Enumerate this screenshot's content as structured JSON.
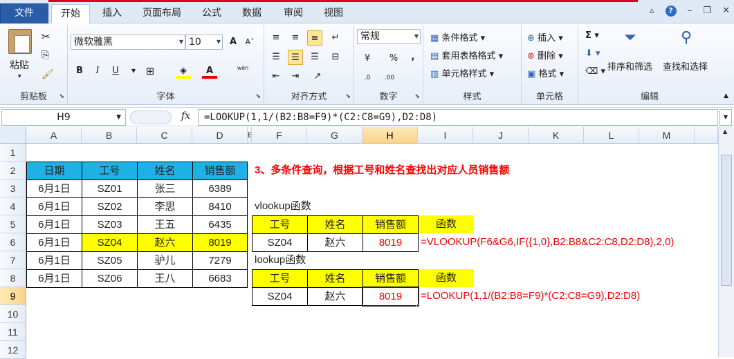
{
  "tabs": {
    "file": "文件",
    "home": "开始",
    "insert": "插入",
    "layout": "页面布局",
    "formulas": "公式",
    "data": "数据",
    "review": "审阅",
    "view": "视图"
  },
  "ribbon": {
    "clipboard": {
      "label": "剪贴板",
      "paste": "粘贴"
    },
    "font": {
      "label": "字体",
      "name": "微软雅黑",
      "size": "10",
      "bold": "B",
      "italic": "I",
      "underline": "U",
      "font_color_glyph": "A",
      "bigger": "A",
      "phonetic": "wén"
    },
    "align": {
      "label": "对齐方式"
    },
    "number": {
      "label": "数字",
      "format": "常规",
      "percent": "%",
      "comma": ","
    },
    "styles": {
      "label": "样式",
      "cond": "条件格式",
      "table": "套用表格格式",
      "cell": "单元格样式"
    },
    "cells": {
      "label": "单元格",
      "insert": "插入",
      "delete": "删除",
      "format": "格式"
    },
    "edit": {
      "label": "编辑",
      "sum": "Σ",
      "sort": "排序和筛选",
      "find": "查找和选择"
    }
  },
  "formula_bar": {
    "name_box": "H9",
    "fx": "fx",
    "formula": "=LOOKUP(1,1/(B2:B8=F9)*(C2:C8=G9),D2:D8)"
  },
  "columns": [
    "A",
    "B",
    "C",
    "D",
    "E",
    "F",
    "G",
    "H",
    "I",
    "J",
    "K",
    "L",
    "M"
  ],
  "rows": [
    "1",
    "2",
    "3",
    "4",
    "5",
    "6",
    "7",
    "8",
    "9",
    "10",
    "11",
    "12"
  ],
  "left_table": {
    "headers": [
      "日期",
      "工号",
      "姓名",
      "销售额"
    ],
    "rows": [
      [
        "6月1日",
        "SZ01",
        "张三",
        "6389"
      ],
      [
        "6月1日",
        "SZ02",
        "李思",
        "8410"
      ],
      [
        "6月1日",
        "SZ03",
        "王五",
        "6435"
      ],
      [
        "6月1日",
        "SZ04",
        "赵六",
        "8019"
      ],
      [
        "6月1日",
        "SZ05",
        "驴儿",
        "7279"
      ],
      [
        "6月1日",
        "SZ06",
        "王八",
        "6683"
      ]
    ]
  },
  "title": "3、多条件查询，根据工号和姓名查找出对应人员销售额",
  "vlookup": {
    "caption": "vlookup函数",
    "headers": [
      "工号",
      "姓名",
      "销售额",
      "函数"
    ],
    "row": [
      "SZ04",
      "赵六",
      "8019"
    ],
    "formula": "=VLOOKUP(F6&G6,IF({1,0},B2:B8&C2:C8,D2:D8),2,0)"
  },
  "lookup": {
    "caption": "lookup函数",
    "headers": [
      "工号",
      "姓名",
      "销售额",
      "函数"
    ],
    "row": [
      "SZ04",
      "赵六",
      "8019"
    ],
    "formula": "=LOOKUP(1,1/(B2:B8=F9)*(C2:C8=G9),D2:D8)"
  },
  "colors": {
    "header_blue": "#1fb1e5",
    "highlight": "#ffff00",
    "red_text": "#e00000",
    "title_red": "#ff0000"
  }
}
